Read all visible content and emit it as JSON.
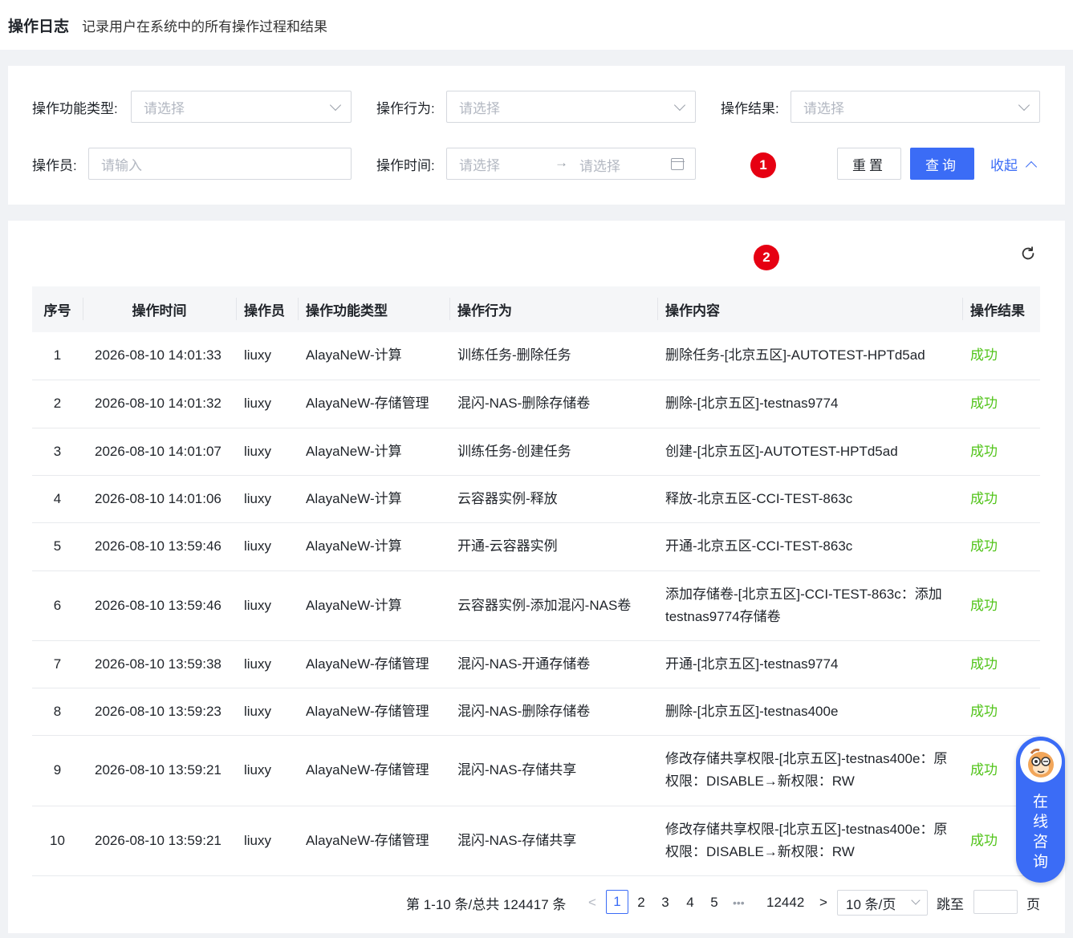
{
  "header": {
    "title": "操作日志",
    "subtitle": "记录用户在系统中的所有操作过程和结果"
  },
  "filters": {
    "func_type": {
      "label": "操作功能类型:",
      "placeholder": "请选择"
    },
    "action": {
      "label": "操作行为:",
      "placeholder": "请选择"
    },
    "result": {
      "label": "操作结果:",
      "placeholder": "请选择"
    },
    "operator": {
      "label": "操作员:",
      "placeholder": "请输入"
    },
    "time": {
      "label": "操作时间:",
      "start_placeholder": "请选择",
      "end_placeholder": "请选择",
      "separator": "→"
    },
    "reset_label": "重置",
    "query_label": "查询",
    "collapse_label": "收起"
  },
  "badges": {
    "one": "1",
    "two": "2"
  },
  "table": {
    "columns": [
      "序号",
      "操作时间",
      "操作员",
      "操作功能类型",
      "操作行为",
      "操作内容",
      "操作结果"
    ],
    "rows": [
      {
        "idx": "1",
        "time": "2026-08-10 14:01:33",
        "user": "liuxy",
        "type": "AlayaNeW-计算",
        "action": "训练任务-删除任务",
        "content": "删除任务-[北京五区]-AUTOTEST-HPTd5ad",
        "result": "成功"
      },
      {
        "idx": "2",
        "time": "2026-08-10 14:01:32",
        "user": "liuxy",
        "type": "AlayaNeW-存储管理",
        "action": "混闪-NAS-删除存储卷",
        "content": "删除-[北京五区]-testnas9774",
        "result": "成功"
      },
      {
        "idx": "3",
        "time": "2026-08-10 14:01:07",
        "user": "liuxy",
        "type": "AlayaNeW-计算",
        "action": "训练任务-创建任务",
        "content": "创建-[北京五区]-AUTOTEST-HPTd5ad",
        "result": "成功"
      },
      {
        "idx": "4",
        "time": "2026-08-10 14:01:06",
        "user": "liuxy",
        "type": "AlayaNeW-计算",
        "action": "云容器实例-释放",
        "content": "释放-北京五区-CCI-TEST-863c",
        "result": "成功"
      },
      {
        "idx": "5",
        "time": "2026-08-10 13:59:46",
        "user": "liuxy",
        "type": "AlayaNeW-计算",
        "action": "开通-云容器实例",
        "content": "开通-北京五区-CCI-TEST-863c",
        "result": "成功"
      },
      {
        "idx": "6",
        "time": "2026-08-10 13:59:46",
        "user": "liuxy",
        "type": "AlayaNeW-计算",
        "action": "云容器实例-添加混闪-NAS卷",
        "content": "添加存储卷-[北京五区]-CCI-TEST-863c：添加testnas9774存储卷",
        "result": "成功"
      },
      {
        "idx": "7",
        "time": "2026-08-10 13:59:38",
        "user": "liuxy",
        "type": "AlayaNeW-存储管理",
        "action": "混闪-NAS-开通存储卷",
        "content": "开通-[北京五区]-testnas9774",
        "result": "成功"
      },
      {
        "idx": "8",
        "time": "2026-08-10 13:59:23",
        "user": "liuxy",
        "type": "AlayaNeW-存储管理",
        "action": "混闪-NAS-删除存储卷",
        "content": "删除-[北京五区]-testnas400e",
        "result": "成功"
      },
      {
        "idx": "9",
        "time": "2026-08-10 13:59:21",
        "user": "liuxy",
        "type": "AlayaNeW-存储管理",
        "action": "混闪-NAS-存储共享",
        "content": "修改存储共享权限-[北京五区]-testnas400e：原权限：DISABLE→新权限：RW",
        "result": "成功"
      },
      {
        "idx": "10",
        "time": "2026-08-10 13:59:21",
        "user": "liuxy",
        "type": "AlayaNeW-存储管理",
        "action": "混闪-NAS-存储共享",
        "content": "修改存储共享权限-[北京五区]-testnas400e：原权限：DISABLE→新权限：RW",
        "result": "成功"
      }
    ]
  },
  "pagination": {
    "summary": "第 1-10 条/总共 124417 条",
    "prev": "<",
    "pages": [
      "1",
      "2",
      "3",
      "4",
      "5"
    ],
    "ellipsis": "•••",
    "last_page": "12442",
    "next": ">",
    "page_size": "10 条/页",
    "jump_label": "跳至",
    "page_suffix": "页"
  },
  "consult": {
    "label": "在线咨询"
  },
  "colors": {
    "primary": "#3b6cf6",
    "success": "#52c41a",
    "badge": "#e60012"
  }
}
